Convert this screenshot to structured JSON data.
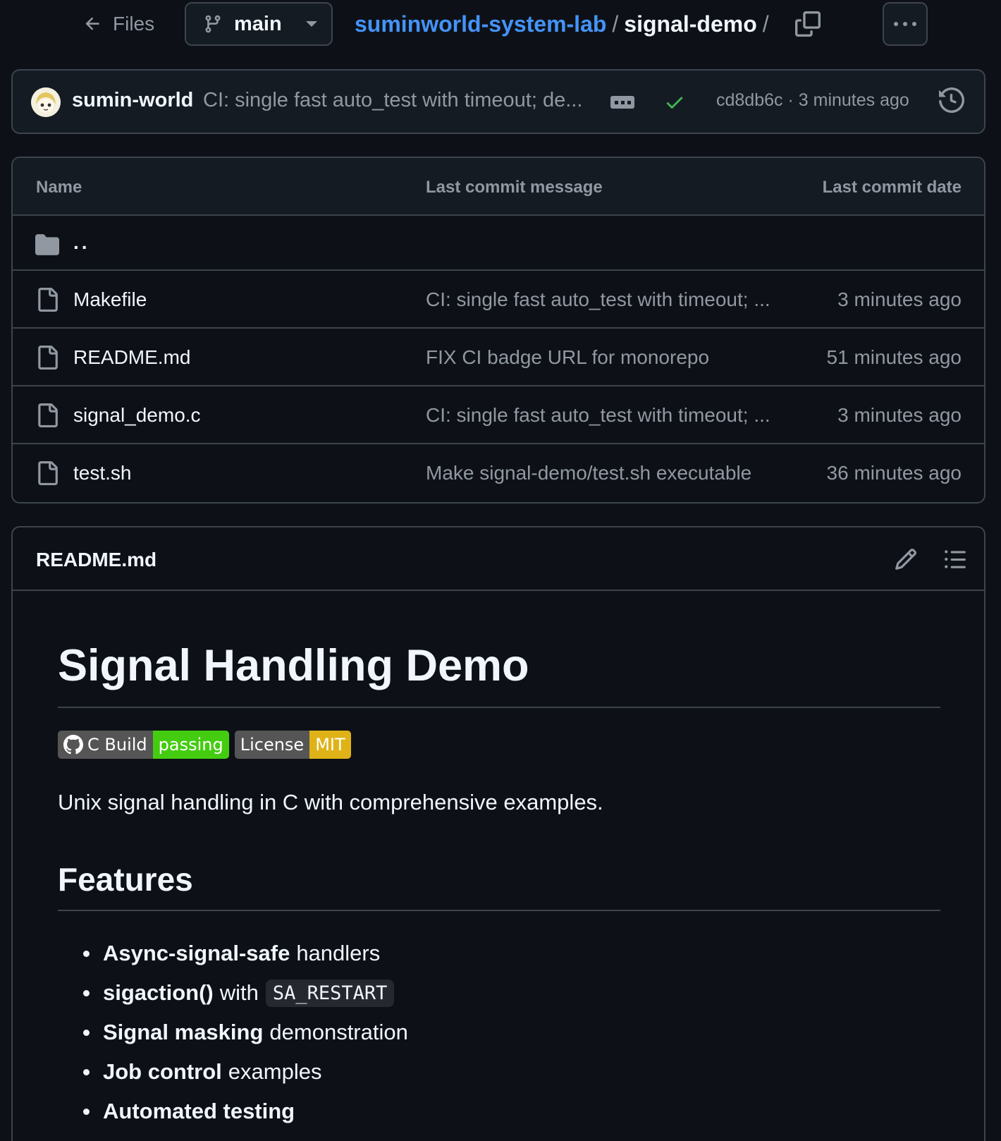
{
  "topbar": {
    "files_label": "Files",
    "branch": "main",
    "owner": "suminworld-system-lab",
    "sep1": "/",
    "repo": "signal-demo",
    "sep2": "/"
  },
  "commit": {
    "author": "sumin-world",
    "message": "CI: single fast auto_test with timeout; de...",
    "sha": "cd8db6c",
    "dot": "·",
    "time": "3 minutes ago",
    "status_color": "#3fb950"
  },
  "table": {
    "headers": {
      "name": "Name",
      "message": "Last commit message",
      "date": "Last commit date"
    },
    "parent": "..",
    "rows": [
      {
        "name": "Makefile",
        "message": "CI: single fast auto_test with timeout; ...",
        "date": "3 minutes ago"
      },
      {
        "name": "README.md",
        "message": "FIX CI badge URL for monorepo",
        "date": "51 minutes ago"
      },
      {
        "name": "signal_demo.c",
        "message": "CI: single fast auto_test with timeout; ...",
        "date": "3 minutes ago"
      },
      {
        "name": "test.sh",
        "message": "Make signal-demo/test.sh executable",
        "date": "36 minutes ago"
      }
    ]
  },
  "readme": {
    "filename": "README.md",
    "title": "Signal Handling Demo",
    "badges": [
      {
        "label": "C Build",
        "value": "passing",
        "color": "#44cc11"
      },
      {
        "label": "License",
        "value": "MIT",
        "color": "#dfb317"
      }
    ],
    "description": "Unix signal handling in C with comprehensive examples.",
    "features_heading": "Features",
    "features": [
      {
        "bold": "Async-signal-safe",
        "text": "handlers",
        "code": ""
      },
      {
        "bold": "sigaction()",
        "text": "with",
        "code": "SA_RESTART"
      },
      {
        "bold": "Signal masking",
        "text": "demonstration",
        "code": ""
      },
      {
        "bold": "Job control",
        "text": "examples",
        "code": ""
      },
      {
        "bold": "Automated testing",
        "text": "",
        "code": ""
      }
    ]
  },
  "colors": {
    "background": "#0d1117",
    "link": "#4493f8",
    "muted": "#9198a1",
    "border": "#3d444d"
  }
}
